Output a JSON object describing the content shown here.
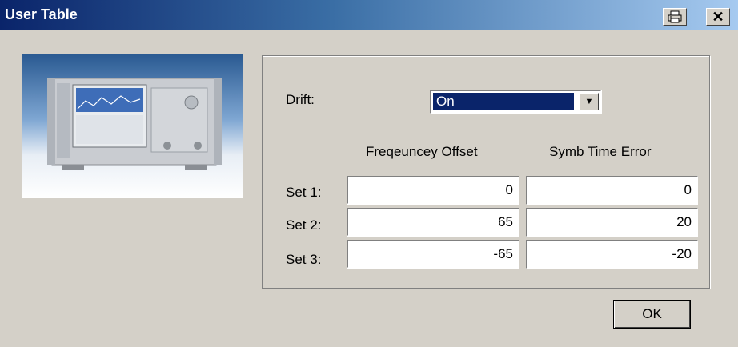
{
  "window": {
    "title": "User Table"
  },
  "title_buttons": {
    "print_icon": "printer-icon",
    "close_glyph": "✕"
  },
  "drift": {
    "label": "Drift:",
    "value": "On",
    "arrow_icon": "chevron-down-icon"
  },
  "columns": {
    "freq": "Freqeuncey Offset",
    "symb": "Symb Time Error"
  },
  "rows": [
    {
      "label": "Set 1:",
      "freq": "0",
      "symb": "0"
    },
    {
      "label": "Set 2:",
      "freq": "65",
      "symb": "20"
    },
    {
      "label": "Set 3:",
      "freq": "-65",
      "symb": "-20"
    }
  ],
  "buttons": {
    "ok": "OK"
  }
}
